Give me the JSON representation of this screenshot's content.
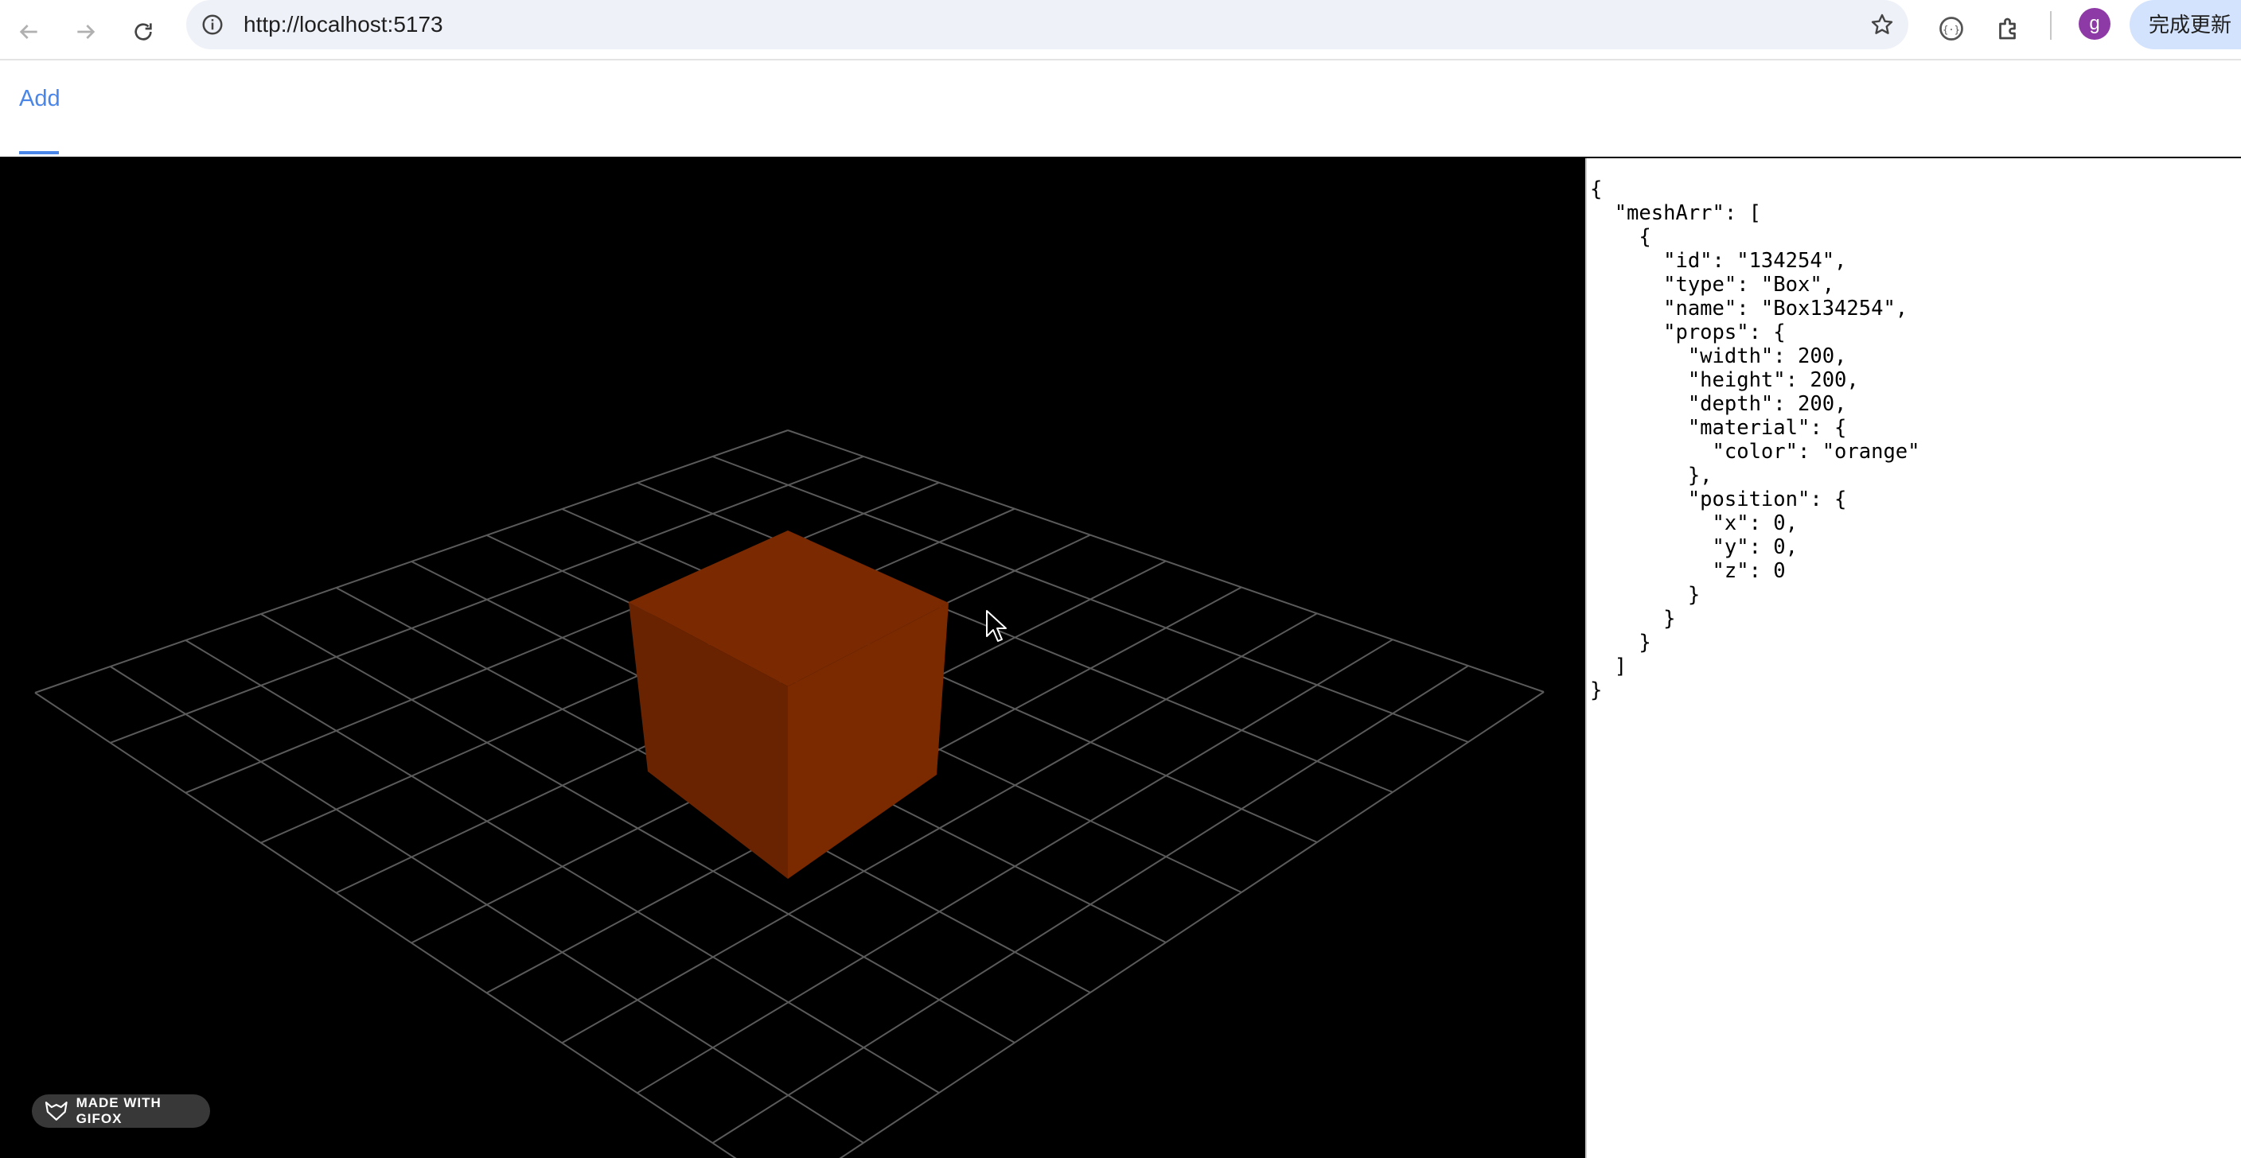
{
  "browser": {
    "url": "http://localhost:5173",
    "profile_initial": "g",
    "update_label": "完成更新",
    "icons": {
      "back": "arrow-left-icon",
      "forward": "arrow-right-icon",
      "reload": "reload-icon",
      "site_info": "info-icon",
      "bookmark": "star-icon",
      "extension1": "devtools-extension-icon",
      "extension2": "puzzle-icon"
    }
  },
  "app": {
    "tabs": [
      {
        "label": "Add",
        "active": true
      }
    ],
    "accent_color": "#4a86e8"
  },
  "scene": {
    "background": "#000000",
    "grid_color": "#555555",
    "box_color": "#7a2900",
    "watermark": "MADE WITH GIFOX"
  },
  "json_panel": {
    "text": "{\n  \"meshArr\": [\n    {\n      \"id\": \"134254\",\n      \"type\": \"Box\",\n      \"name\": \"Box134254\",\n      \"props\": {\n        \"width\": 200,\n        \"height\": 200,\n        \"depth\": 200,\n        \"material\": {\n          \"color\": \"orange\"\n        },\n        \"position\": {\n          \"x\": 0,\n          \"y\": 0,\n          \"z\": 0\n        }\n      }\n    }\n  ]\n}"
  }
}
